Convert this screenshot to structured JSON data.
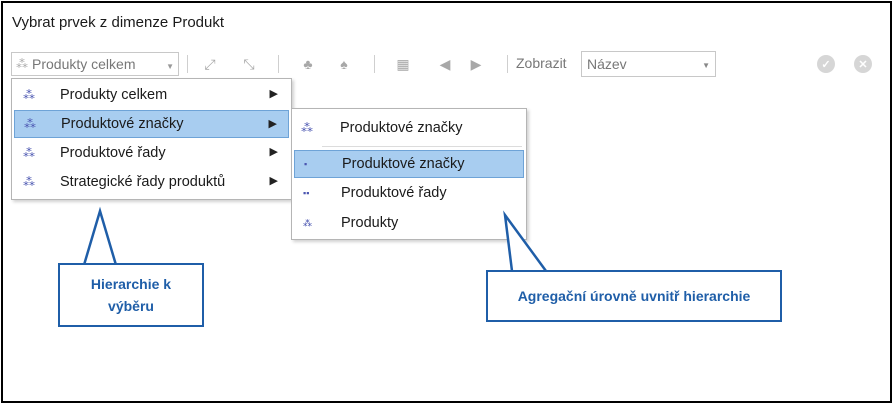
{
  "window": {
    "title": "Vybrat prvek z dimenze Produkt"
  },
  "toolbar": {
    "hierarchy_combo": {
      "value": "Produkty celkem"
    },
    "show_label": "Zobrazit",
    "display_combo": {
      "value": "Název"
    }
  },
  "hierarchy_menu": {
    "items": [
      {
        "label": "Produkty celkem",
        "selected": false
      },
      {
        "label": "Produktové značky",
        "selected": true
      },
      {
        "label": "Produktové řady",
        "selected": false
      },
      {
        "label": "Strategické řady produktů",
        "selected": false
      }
    ]
  },
  "level_menu": {
    "header": "Produktové značky",
    "items": [
      {
        "label": "Produktové značky",
        "selected": true
      },
      {
        "label": "Produktové řady",
        "selected": false
      },
      {
        "label": "Produkty",
        "selected": false
      }
    ]
  },
  "callouts": {
    "hierarchy": {
      "line1": "Hierarchie k",
      "line2": "výběru"
    },
    "levels": {
      "text": "Agregační úrovně uvnitř hierarchie"
    }
  },
  "colors": {
    "selection": "#a8cdf0",
    "selection_border": "#6ea3d7",
    "callout": "#1f5ea8"
  }
}
